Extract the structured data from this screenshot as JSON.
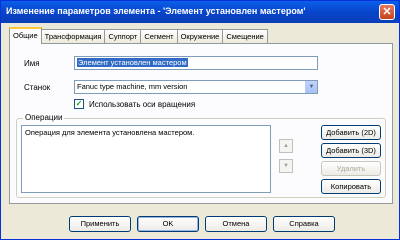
{
  "window": {
    "title": "Изменение параметров элемента - 'Элемент установлен мастером'",
    "close_glyph": "✕"
  },
  "tabs": [
    {
      "label": "Общие",
      "active": true
    },
    {
      "label": "Трансформация"
    },
    {
      "label": "Суппорт"
    },
    {
      "label": "Сегмент"
    },
    {
      "label": "Окружение"
    },
    {
      "label": "Смещение"
    }
  ],
  "general": {
    "name_label": "Имя",
    "name_value": "Элемент установлен мастером",
    "machine_label": "Станок",
    "machine_value": "Fanuc type machine, mm version",
    "use_rotation_label": "Использовать оси вращения",
    "use_rotation_checked": true,
    "check_glyph": "✓",
    "dropdown_glyph": "▼"
  },
  "operations": {
    "legend": "Операции",
    "items": [
      "Операция для элемента установлена мастером."
    ],
    "up_glyph": "▲",
    "down_glyph": "▼",
    "add_2d": "Добавить (2D)",
    "add_3d": "Добавить (3D)",
    "delete": "Удалить",
    "copy": "Копировать"
  },
  "footer": {
    "apply": "Применить",
    "ok": "OK",
    "cancel": "Отмена",
    "help": "Справка"
  },
  "colors": {
    "title_bar": "#0a5fe8",
    "selection": "#316ac5",
    "dialog_bg": "#ece9d8"
  }
}
